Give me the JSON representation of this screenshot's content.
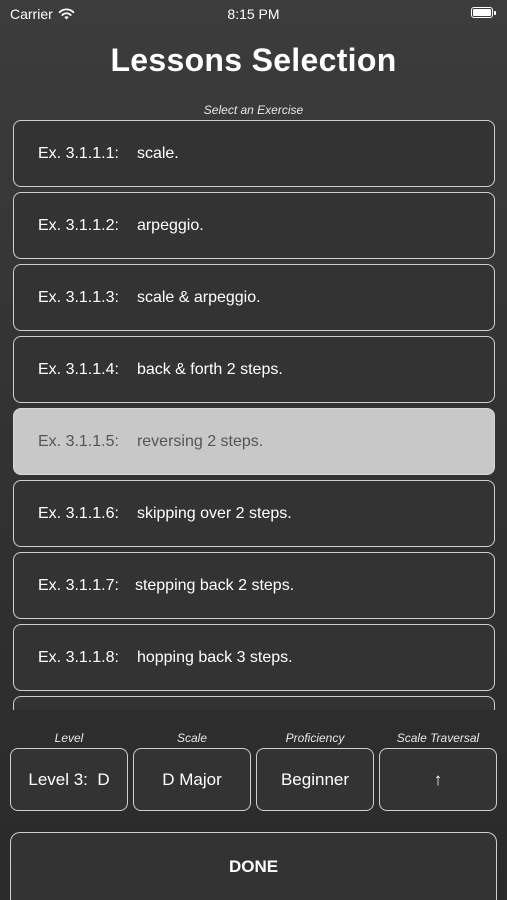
{
  "status_bar": {
    "carrier": "Carrier",
    "time": "8:15 PM",
    "icons": [
      "wifi-icon",
      "battery-icon"
    ]
  },
  "title": "Lessons Selection",
  "exercise_list": {
    "caption": "Select an Exercise",
    "selected_index": 4,
    "items": [
      {
        "code": "Ex. 3.1.1.1:",
        "description": "scale."
      },
      {
        "code": "Ex. 3.1.1.2:",
        "description": "arpeggio."
      },
      {
        "code": "Ex. 3.1.1.3:",
        "description": "scale & arpeggio."
      },
      {
        "code": "Ex. 3.1.1.4:",
        "description": "back & forth 2 steps."
      },
      {
        "code": "Ex. 3.1.1.5:",
        "description": "reversing 2 steps."
      },
      {
        "code": "Ex. 3.1.1.6:",
        "description": "skipping over 2 steps."
      },
      {
        "code": "Ex. 3.1.1.7:",
        "description": "stepping back 2 steps."
      },
      {
        "code": "Ex. 3.1.1.8:",
        "description": "hopping back 3 steps."
      }
    ]
  },
  "pickers": {
    "level": {
      "label": "Level",
      "value": "Level 3:  D"
    },
    "scale": {
      "label": "Scale",
      "value": "D Major"
    },
    "proficiency": {
      "label": "Proficiency",
      "value": "Beginner"
    },
    "traversal": {
      "label": "Scale Traversal",
      "value": "↑"
    }
  },
  "done_label": "DONE",
  "colors": {
    "background": "#333333",
    "border": "#cfcfcf",
    "selected_background": "#c8c8c8",
    "text": "#ffffff"
  }
}
